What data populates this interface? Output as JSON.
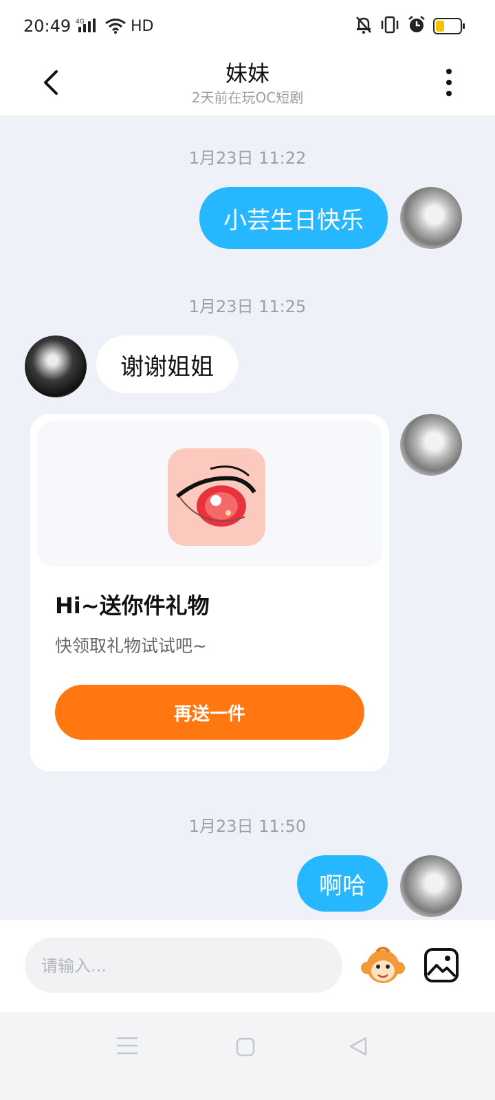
{
  "status_bar": {
    "time": "20:49",
    "network": "4G",
    "hd": "HD",
    "battery_level": 0.35
  },
  "header": {
    "title": "妹妹",
    "subtitle": "2天前在玩OC短剧"
  },
  "messages": [
    {
      "timestamp": "1月23日 11:22",
      "sender": "self",
      "text": "小芸生日快乐"
    },
    {
      "timestamp": "1月23日 11:25",
      "sender": "other",
      "text": "谢谢姐姐"
    },
    {
      "sender": "self",
      "type": "gift",
      "gift": {
        "title": "Hi~送你件礼物",
        "desc": "快领取礼物试试吧~",
        "button": "再送一件"
      }
    },
    {
      "timestamp": "1月23日 11:50",
      "sender": "self",
      "text": "啊哈"
    }
  ],
  "input": {
    "placeholder": "请输入..."
  },
  "colors": {
    "accent_bubble": "#27b7ff",
    "gift_button": "#ff7710",
    "background": "#eef1f7"
  }
}
